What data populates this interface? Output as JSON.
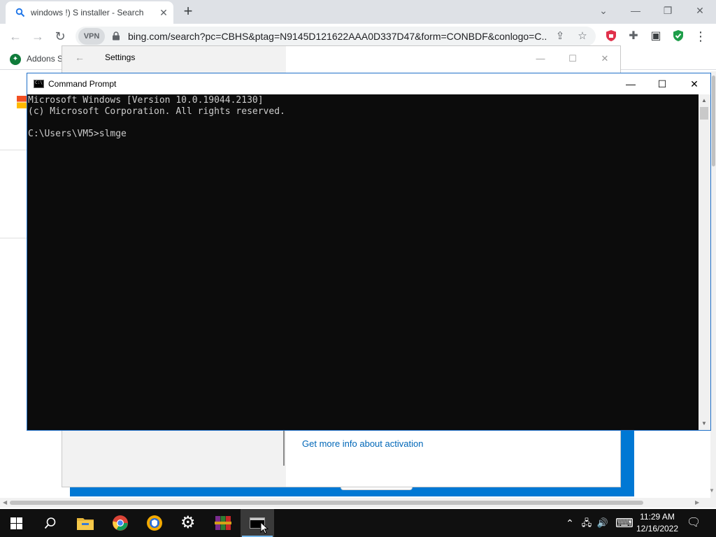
{
  "browser": {
    "tab_title": "windows !) S installer - Search",
    "tab_close": "✕",
    "new_tab": "+",
    "vpn_label": "VPN",
    "url": "bing.com/search?pc=CBHS&ptag=N9145D121622AAA0D337D47&form=CONBDF&conlogo=C...",
    "bookmark_label": "Addons S",
    "window_controls": {
      "minimize": "—",
      "restore": "❐",
      "close": "✕",
      "tab_search": "⌄"
    },
    "toolbar_glyphs": {
      "back": "←",
      "forward": "→",
      "reload": "↻",
      "share": "⇪",
      "star": "☆",
      "puzzle": "✚",
      "sidebar": "▣",
      "menu": "⋮"
    }
  },
  "settings": {
    "title": "Settings",
    "back": "←",
    "controls": {
      "minimize": "—",
      "maximize": "☐",
      "close": "✕"
    },
    "activation_link": "Get more info about activation"
  },
  "cmd": {
    "title": "Command Prompt",
    "icon_text": "C:\\",
    "controls": {
      "minimize": "—",
      "maximize": "☐",
      "close": "✕"
    },
    "lines": [
      "Microsoft Windows [Version 10.0.19044.2130]",
      "(c) Microsoft Corporation. All rights reserved.",
      "",
      "C:\\Users\\VM5>slmge"
    ]
  },
  "taskbar": {
    "time": "11:29 AM",
    "date": "12/16/2022",
    "tray_glyphs": {
      "chevron": "⌃",
      "network": "🖧",
      "volume": "🔊",
      "keyboard": "⌨",
      "notifications": "🗨"
    }
  }
}
